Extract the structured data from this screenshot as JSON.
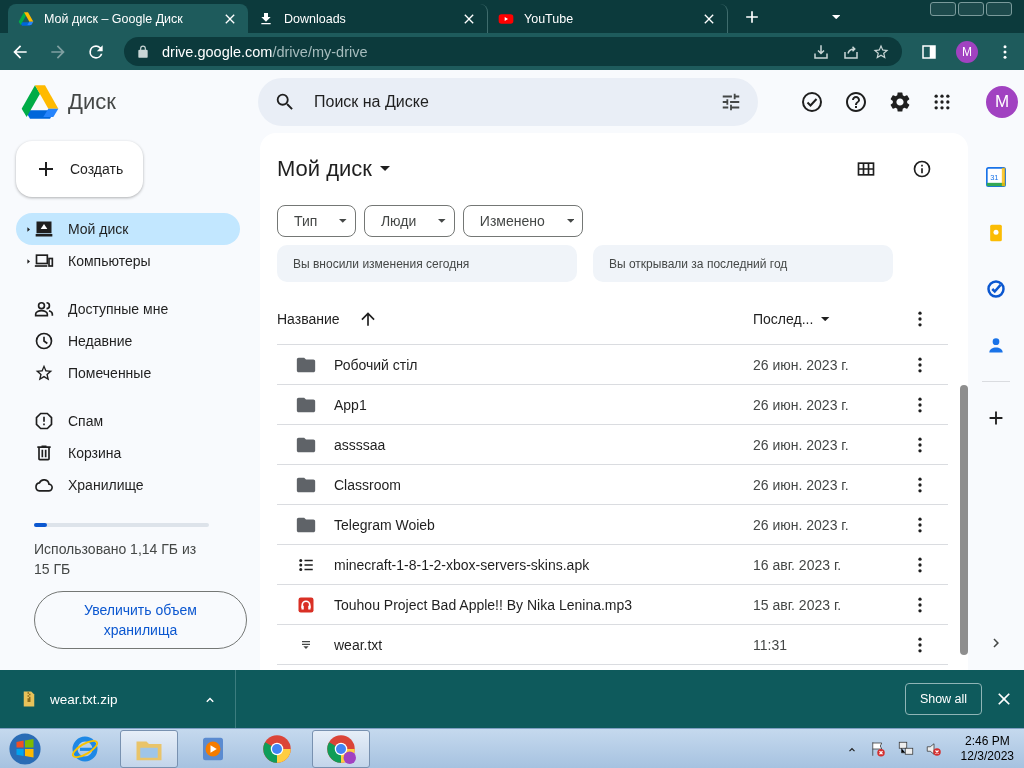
{
  "browser": {
    "tabs": [
      {
        "title": "Мой диск – Google Диск",
        "kind": "drive",
        "selected": true
      },
      {
        "title": "Downloads",
        "kind": "download",
        "selected": false
      },
      {
        "title": "YouTube",
        "kind": "youtube",
        "selected": false
      }
    ],
    "url": {
      "host": "drive.google.com",
      "path": "/drive/my-drive"
    },
    "profile": "M"
  },
  "drive": {
    "app_name": "Диск",
    "search": {
      "placeholder": "Поиск на Диске"
    },
    "avatar": "M",
    "new_button": "Создать",
    "nav": [
      [
        {
          "label": "Мой диск",
          "kind": "drive",
          "expandable": true,
          "selected": true
        },
        {
          "label": "Компьютеры",
          "kind": "computer",
          "expandable": true,
          "selected": false
        }
      ],
      [
        {
          "label": "Доступные мне",
          "kind": "people",
          "expandable": false,
          "selected": false
        },
        {
          "label": "Недавние",
          "kind": "clock",
          "expandable": false,
          "selected": false
        },
        {
          "label": "Помеченные",
          "kind": "star",
          "expandable": false,
          "selected": false
        }
      ],
      [
        {
          "label": "Спам",
          "kind": "spam",
          "expandable": false,
          "selected": false
        },
        {
          "label": "Корзина",
          "kind": "trash",
          "expandable": false,
          "selected": false
        },
        {
          "label": "Хранилище",
          "kind": "cloud",
          "expandable": false,
          "selected": false
        }
      ]
    ],
    "storage": {
      "level": 0.076,
      "text": "Использовано 1,14 ГБ из 15 ГБ",
      "button": "Увеличить объем хранилища"
    },
    "main": {
      "title": "Мой диск",
      "filters": [
        "Тип",
        "Люди",
        "Изменено"
      ],
      "suggestions": [
        "Вы вносили изменения сегодня",
        "Вы открывали за последний год"
      ],
      "columns": {
        "name": "Название",
        "modified": "Послед..."
      },
      "rows": [
        {
          "name": "Робочий стіл",
          "kind": "folder",
          "modified": "26 июн. 2023 г."
        },
        {
          "name": "App1",
          "kind": "folder",
          "modified": "26 июн. 2023 г."
        },
        {
          "name": "assssaa",
          "kind": "folder",
          "modified": "26 июн. 2023 г."
        },
        {
          "name": "Classroom",
          "kind": "folder",
          "modified": "26 июн. 2023 г."
        },
        {
          "name": "Telegram Woieb",
          "kind": "folder",
          "modified": "26 июн. 2023 г."
        },
        {
          "name": "minecraft-1-8-1-2-xbox-servers-skins.apk",
          "kind": "apk",
          "modified": "16 авг. 2023 г."
        },
        {
          "name": "Touhou Project Bad Apple!! By Nika Lenina.mp3",
          "kind": "audio",
          "modified": "15 авг. 2023 г."
        },
        {
          "name": "wear.txt",
          "kind": "text",
          "modified": "11:31"
        }
      ]
    },
    "side_panel": {
      "calendar_day": "31"
    }
  },
  "download_bar": {
    "item": "wear.txt.zip",
    "show_all": "Show all"
  },
  "taskbar": {
    "apps": [
      {
        "kind": "ie",
        "selected": false
      },
      {
        "kind": "explorer",
        "selected": true
      },
      {
        "kind": "media",
        "selected": false
      },
      {
        "kind": "chrome",
        "selected": false
      },
      {
        "kind": "chrome-profile",
        "selected": true
      }
    ],
    "time": "2:46 PM",
    "date": "12/3/2023"
  }
}
